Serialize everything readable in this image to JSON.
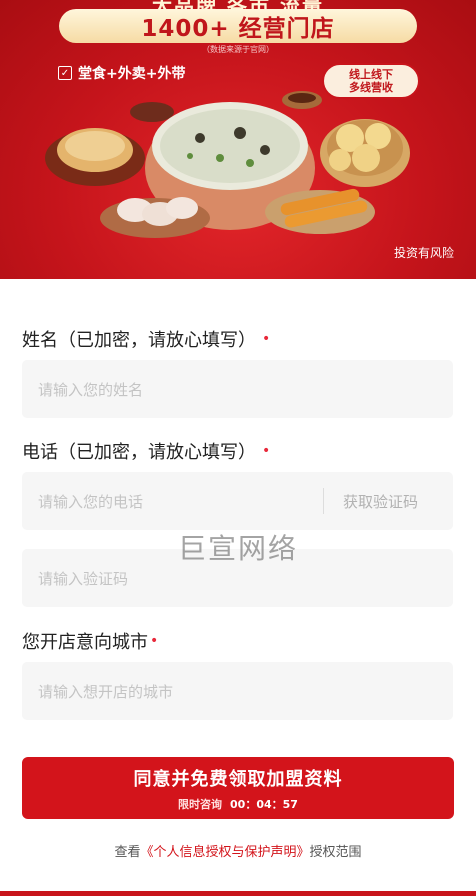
{
  "banner": {
    "top_line": "大品牌 各市 流量",
    "stores": "1400+ 经营门店",
    "source_note": "（数据来源于官网）",
    "services": "堂食+外卖+外带",
    "online_badge": [
      "线上线下",
      "多线营收"
    ],
    "risk_notice": "投资有风险",
    "brand_red": "#c5141b",
    "cream": "#f6dba4"
  },
  "form": {
    "name": {
      "label": "姓名（已加密，请放心填写）",
      "required_mark": "•",
      "placeholder": "请输入您的姓名"
    },
    "phone": {
      "label": "电话（已加密，请放心填写）",
      "required_mark": "•",
      "placeholder": "请输入您的电话",
      "get_code": "获取验证码"
    },
    "code": {
      "placeholder": "请输入验证码"
    },
    "city": {
      "label": "您开店意向城市",
      "required_mark": "•",
      "placeholder": "请输入想开店的城市"
    }
  },
  "watermark": "巨宣网络",
  "submit": {
    "label": "同意并免费领取加盟资料",
    "countdown_label": "限时咨询",
    "countdown": "00：04：57",
    "color": "#d3141b"
  },
  "policy": {
    "prefix": "查看",
    "link": "《个人信息授权与保护声明》",
    "suffix": "授权范围"
  }
}
